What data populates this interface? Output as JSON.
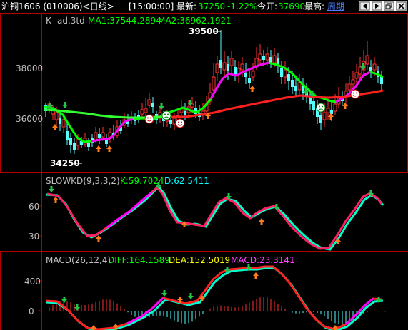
{
  "header": {
    "title": "沪铜1606 (010006)<日线>",
    "time": "[15:00:00]",
    "latest_label": "最新:",
    "latest_value": "37250",
    "change": "-1.22%",
    "open_label": "今开:",
    "open_value": "37690",
    "high_label": "最高:",
    "period_link": "周期"
  },
  "main_panel": {
    "prefix": "K",
    "ind_name": "ad.3td",
    "ma1": "MA1:37544.2894",
    "ma2": "MA2:36962.1921",
    "y_ticks": [
      "38000",
      "36000"
    ],
    "high_mark": "39500",
    "low_mark": "34250"
  },
  "kd_panel": {
    "name": "SLOWKD(9,3,3,2)",
    "k": "K:59.7024",
    "d": "D:62.5411",
    "y_ticks": [
      "60",
      "30"
    ]
  },
  "macd_panel": {
    "name": "MACD(26,12,4)",
    "diff": "DIFF:164.1589",
    "dea": "DEA:152.5019",
    "macd": "MACD:23.3141",
    "y_ticks": [
      "400",
      "0"
    ]
  },
  "colors": {
    "background": "#000000",
    "up": "#ff3232",
    "down": "#54ffff",
    "ma1": "#00ff00",
    "ma2": "#ff2020",
    "k_line": "#00ffcc",
    "d_line": "#ff00ff",
    "label_yellow": "#ffff00",
    "grid": "#b00000"
  }
}
